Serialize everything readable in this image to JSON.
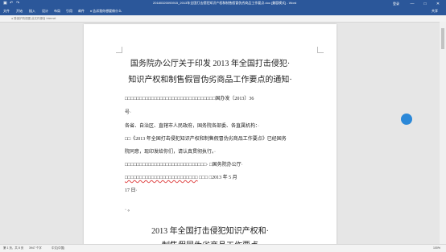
{
  "window": {
    "title": "20180320093915_2013年全国打击侵犯知识产权和制售假冒伪劣商品工作要点.doc [兼容模式] - Word",
    "account": "登录",
    "min": "—",
    "max": "□",
    "close": "✕"
  },
  "ribbon": {
    "tabs": [
      "文件",
      "开始",
      "插入",
      "设计",
      "布局",
      "引用",
      "邮件",
      "审阅",
      "视图"
    ],
    "tell_me": "告诉我你想要做什么",
    "share": "共享",
    "hint": "● 受保护的视图 此文件源自 Internet"
  },
  "document": {
    "title_line1": "国务院办公厅关于印发 2013 年全国打击侵犯·",
    "title_line2": "知识产权和制售假冒伪劣商品工作要点的通知·",
    "p1": "□□□□□□□□□□□□□□□□□□□□□□□□□□□□□□□国办发〔2013〕36",
    "p2": "号·",
    "p3": "各省、自治区、直辖市人民政府，国务院各部委、各直属机构：·",
    "p4": "□□《2013 年全国打击侵犯知识产权和制售假冒伪劣商品工作要点》已经国务",
    "p5": "院同意，现印发给你们，请认真贯彻执行。·",
    "p6": "□□□□□□□□□□□□□□□□□□□□□□□□□□□□·    □国务院办公厅·",
    "p7a": "□□□□□□□□□□□□□□□□□□□□□□□□□",
    "p7b": " □□□ □2013 年 5 月",
    "p8": "17 日·",
    "p9": "· 。",
    "subtitle_line1": "2013 年全国打击侵犯知识产权和·",
    "subtitle_line2": "制售假冒伪劣商品工作要点"
  },
  "status": {
    "page": "第 1 页，共 8 页",
    "words": "3947 个字",
    "lang": "中文(中国)",
    "zoom": "100%"
  }
}
